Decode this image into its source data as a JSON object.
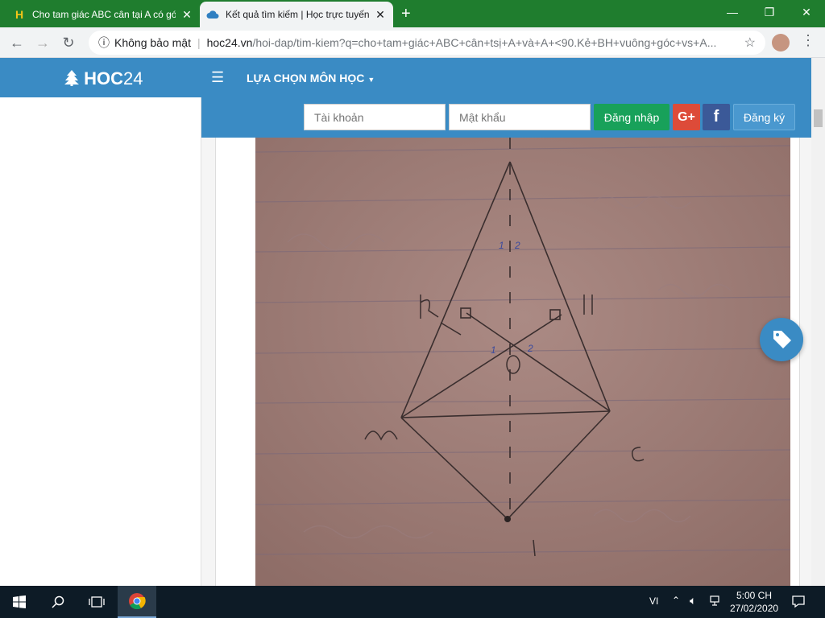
{
  "browser": {
    "tabs": [
      {
        "title": "Cho tam giác ABC cân tại A có gó",
        "favicon": "hoc24-h-icon"
      },
      {
        "title": "Kết quả tìm kiếm | Học trực tuyến",
        "favicon": "cloud-icon"
      }
    ],
    "address": {
      "security_label": "Không bảo mật",
      "host": "hoc24.vn",
      "path": "/hoi-dap/tim-kiem?q=cho+tam+giác+ABC+cân+tsị+A+và+A+<90.Kẻ+BH+vuông+góc+vs+A..."
    }
  },
  "site": {
    "logo_text": "HOC",
    "logo_num": "24",
    "subject_menu": "LỰA CHỌN MÔN HỌC",
    "login": {
      "username_placeholder": "Tài khoản",
      "password_placeholder": "Mật khẩu",
      "login_label": "Đăng nhập",
      "gplus_label": "G+",
      "facebook_label": "f",
      "register_label": "Đăng ký"
    }
  },
  "taskbar": {
    "lang": "VI",
    "time": "5:00 CH",
    "date": "27/02/2020"
  },
  "colors": {
    "chrome_green": "#1f7d2e",
    "site_blue": "#3a8bc4",
    "login_green": "#18a15a",
    "gplus_red": "#dd4b39",
    "facebook_blue": "#3b5998"
  }
}
